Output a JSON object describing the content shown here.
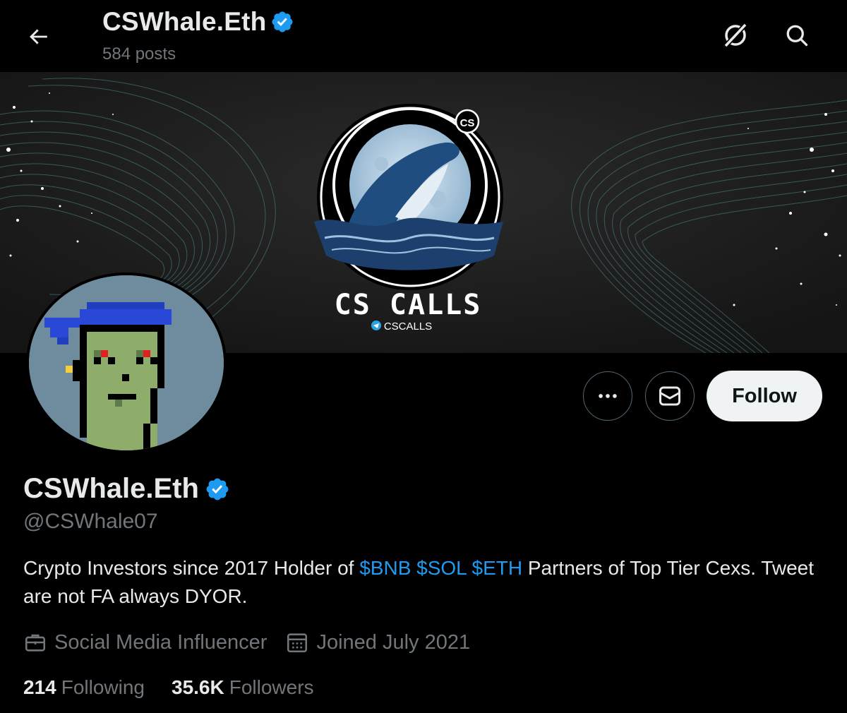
{
  "header": {
    "title": "CSWhale.Eth",
    "posts_count": "584 posts"
  },
  "banner": {
    "logo_text": "CS CALLS",
    "logo_badge": "CS",
    "telegram_handle": "CSCALLS"
  },
  "actions": {
    "follow_label": "Follow"
  },
  "profile": {
    "display_name": "CSWhale.Eth",
    "handle": "@CSWhale07",
    "bio_part1": "Crypto Investors since 2017 Holder of ",
    "bio_tags": "$BNB $SOL $ETH",
    "bio_part2": " Partners of Top Tier Cexs. Tweet are not FA always DYOR.",
    "category": "Social Media Influencer",
    "joined": "Joined July 2021",
    "following_count": "214",
    "following_label": "Following",
    "followers_count": "35.6K",
    "followers_label": "Followers"
  },
  "icons": {
    "back": "arrow-left-icon",
    "grok": "grok-icon",
    "search": "search-icon",
    "verified": "verified-badge-icon",
    "more": "more-dots-icon",
    "message": "envelope-icon",
    "category": "briefcase-icon",
    "joined": "calendar-icon"
  },
  "colors": {
    "background": "#000000",
    "text_primary": "#e7e9ea",
    "text_secondary": "#71767b",
    "accent": "#1d9bf0",
    "follow_button_bg": "#eff3f4"
  }
}
